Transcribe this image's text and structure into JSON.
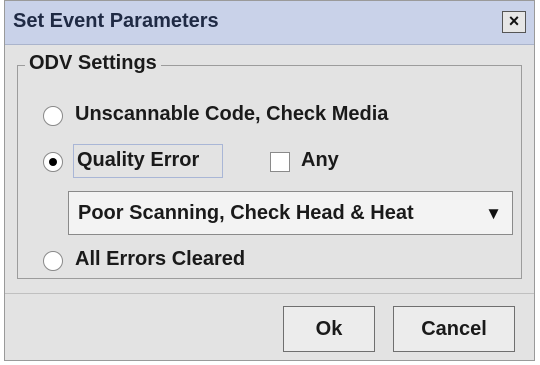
{
  "window": {
    "title": "Set Event Parameters",
    "close_glyph": "×"
  },
  "group": {
    "title": "ODV Settings"
  },
  "options": {
    "unscannable": {
      "label": "Unscannable Code, Check Media",
      "selected": false
    },
    "quality": {
      "label": "Quality Error",
      "selected": true
    },
    "cleared": {
      "label": "All Errors Cleared",
      "selected": false
    }
  },
  "any_checkbox": {
    "label": "Any",
    "checked": false
  },
  "error_select": {
    "value": "Poor Scanning, Check Head & Heat",
    "arrow_glyph": "▼"
  },
  "buttons": {
    "ok": "Ok",
    "cancel": "Cancel"
  }
}
